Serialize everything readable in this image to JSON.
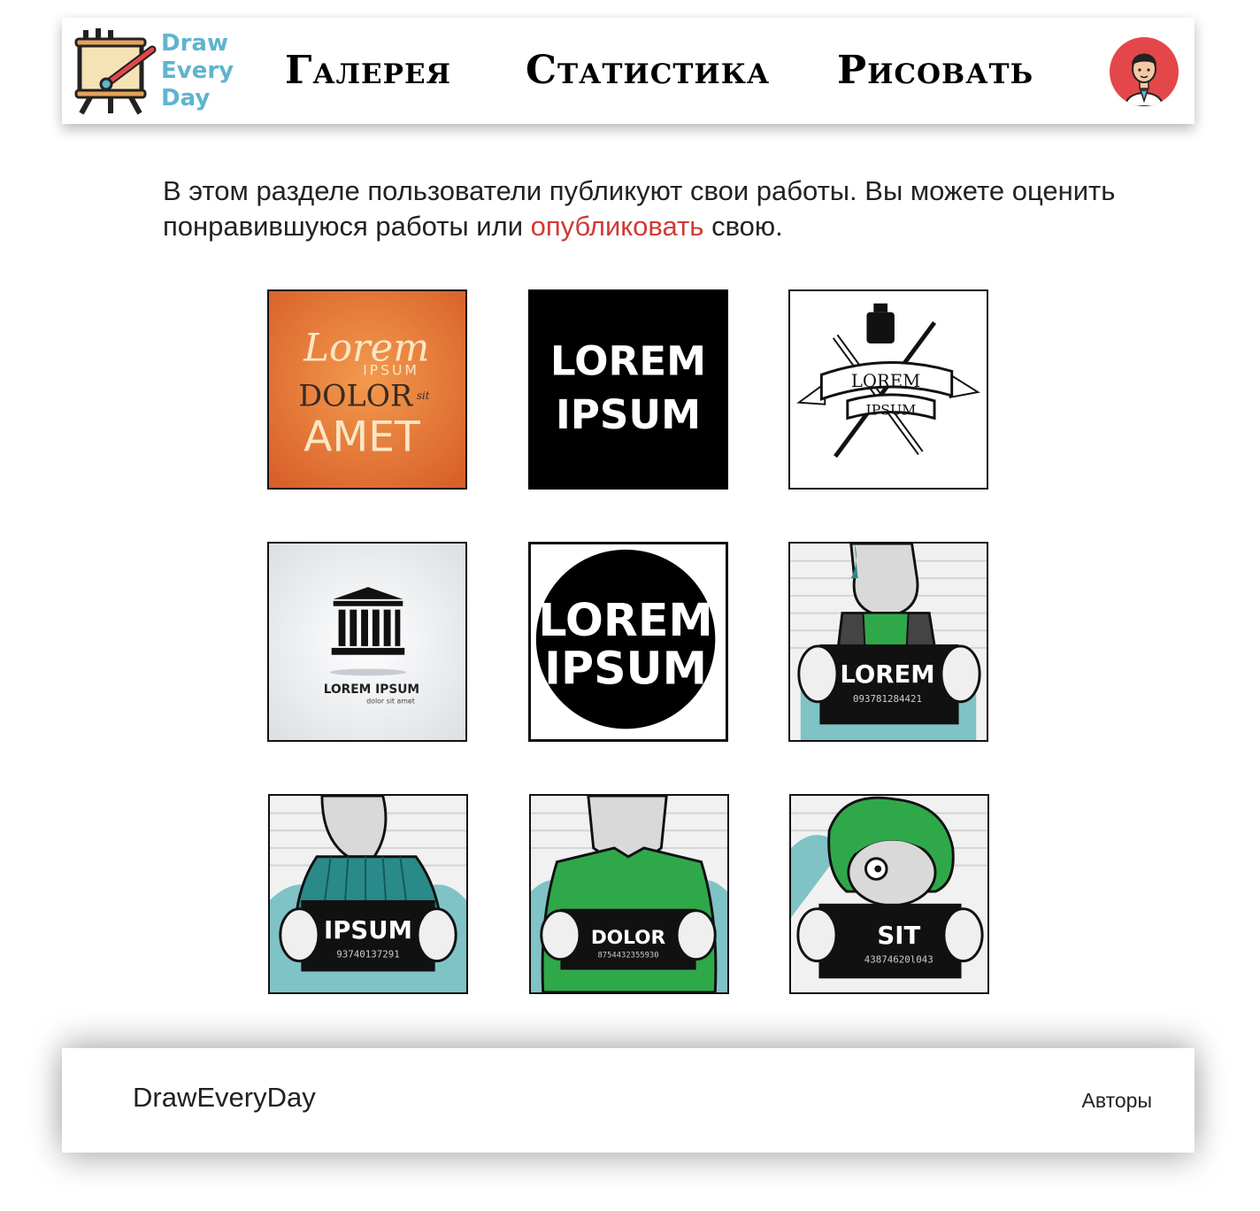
{
  "header": {
    "logo": {
      "line1": "Draw",
      "line2": "Every",
      "line3": "Day",
      "icon": "easel-paintbrush-icon"
    },
    "nav": [
      {
        "label": "Галерея"
      },
      {
        "label": "Статистика"
      },
      {
        "label": "Рисовать"
      }
    ],
    "avatar": {
      "icon": "user-avatar-icon",
      "color": "#e4474a"
    }
  },
  "intro": {
    "text_before": "В этом разделе пользователи публикуют свои работы. Вы можете оценить понравившуюся работы или ",
    "link": "опубликовать",
    "text_after": " свою."
  },
  "gallery": [
    {
      "lines": [
        "Lorem",
        "IPSUM",
        "DOLOR",
        "sit",
        "AMET"
      ],
      "style": "orange-lettering"
    },
    {
      "lines": [
        "LOREM",
        "IPSUM"
      ],
      "style": "black-square"
    },
    {
      "lines": [
        "LOREM",
        "IPSUM"
      ],
      "style": "ink-banner"
    },
    {
      "lines": [
        "LOREM IPSUM",
        "dolor sit amet"
      ],
      "style": "temple-logo"
    },
    {
      "lines": [
        "LOREM",
        "IPSUM"
      ],
      "style": "black-circle"
    },
    {
      "lines": [
        "LOREM",
        "093781284421"
      ],
      "style": "mugshot"
    },
    {
      "lines": [
        "IPSUM",
        "93740137291"
      ],
      "style": "mugshot"
    },
    {
      "lines": [
        "DOLOR",
        "8754432355930"
      ],
      "style": "mugshot"
    },
    {
      "lines": [
        "SIT",
        "43874620l043"
      ],
      "style": "mugshot"
    }
  ],
  "colors": {
    "accent_link": "#d03a35",
    "logo_text": "#5fb4cf",
    "orange_tile": "#ea7a36",
    "mugshot_green": "#2fa84a",
    "mugshot_teal": "#7fc3c6"
  },
  "footer": {
    "brand": "DrawEveryDay",
    "link": "Авторы"
  }
}
